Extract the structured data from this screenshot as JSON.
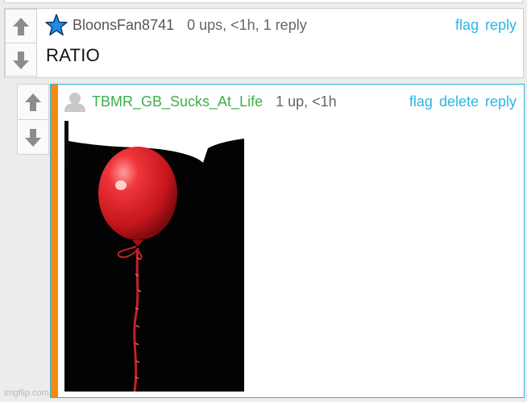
{
  "comments": [
    {
      "author": "BloonsFan8741",
      "stats": "0 ups, <1h, 1 reply",
      "body": "RATIO",
      "actions": [
        "flag",
        "reply"
      ]
    },
    {
      "author": "TBMR_GB_Sucks_At_Life",
      "stats": "1 up, <1h",
      "actions": [
        "flag",
        "delete",
        "reply"
      ]
    }
  ],
  "watermark": "imgflip.com",
  "colors": {
    "link": "#2bb5e6",
    "author_highlight": "#3fae49",
    "reply_bar": "#f5890f",
    "star": "#1c8de0"
  }
}
